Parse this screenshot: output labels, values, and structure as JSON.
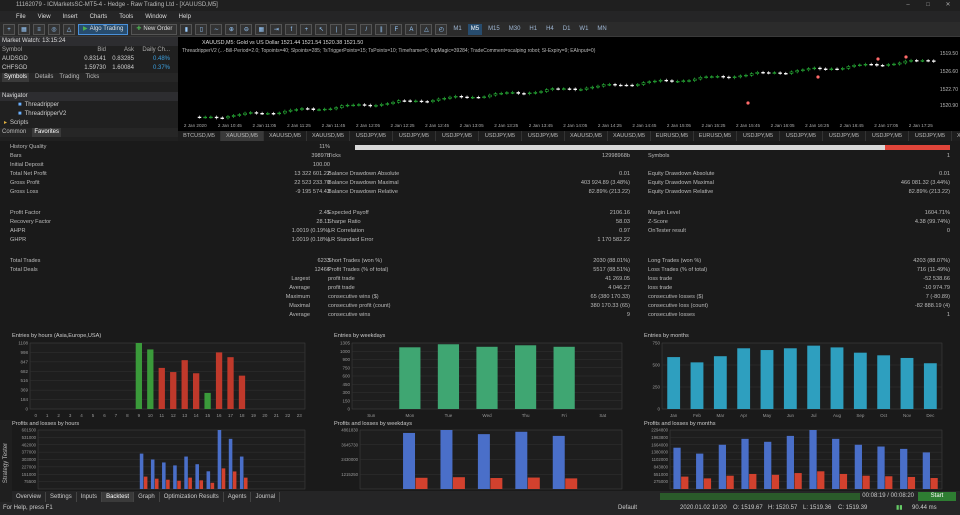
{
  "window": {
    "title": "11162079 - ICMarketsSC-MT5-4 - Hedge - Raw Trading Ltd - [XAUUSD,M5]"
  },
  "menu": [
    "File",
    "View",
    "Insert",
    "Charts",
    "Tools",
    "Window",
    "Help"
  ],
  "toolbar": {
    "algo_label": "Algo Trading",
    "new_order_label": "New Order",
    "timeframes": [
      "M1",
      "M5",
      "M15",
      "M30",
      "H1",
      "H4",
      "D1",
      "W1",
      "MN"
    ],
    "selected_timeframe": "M5"
  },
  "market_watch": {
    "title": "Market Watch: 13:15:24",
    "columns": [
      "Symbol",
      "Bid",
      "Ask",
      "Daily Ch..."
    ],
    "rows": [
      {
        "symbol": "AUDSGD",
        "bid": "0.83141",
        "ask": "0.83285",
        "change": "0.48%"
      },
      {
        "symbol": "CHFSGD",
        "bid": "1.59730",
        "ask": "1.60084",
        "change": "0.37%"
      }
    ],
    "tabs": [
      "Symbols",
      "Details",
      "Trading",
      "Ticks"
    ]
  },
  "navigator": {
    "title": "Navigator",
    "items": [
      "Threadripper",
      "ThreadripperV2",
      "Scripts"
    ],
    "tabs": [
      "Common",
      "Favorites"
    ]
  },
  "chart": {
    "header": "XAUUSD,M5: Gold vs US Dollar 1521.44 1521.54 1520.38 1521.50",
    "params": "ThreadripperV2 (...-Bill-Period=2.0; Topoints=40; Slpoints=285; TsTriggerPoints=15; TsPoints=10; Timeframe=5; InpMagic=39284; TradeComment=scalping robot; Sl-Expiry=9; EAInput=0)",
    "price_labels": [
      "1519.50",
      "1526.60",
      "1522.70",
      "1520.90"
    ],
    "time_labels": [
      "2 Jan 2020",
      "2 Jan 10:45",
      "2 Jan 11:05",
      "2 Jan 11:25",
      "2 Jan 11:45",
      "2 Jan 12:05",
      "2 Jan 12:25",
      "2 Jan 12:45",
      "2 Jan 13:05",
      "2 Jan 13:25",
      "2 Jan 13:45",
      "2 Jan 14:05",
      "2 Jan 14:25",
      "2 Jan 14:45",
      "2 Jan 15:05",
      "2 Jan 15:25",
      "2 Jan 15:45",
      "2 Jan 16:05",
      "2 Jan 16:25",
      "2 Jan 16:45",
      "2 Jan 17:05",
      "2 Jan 17:25"
    ],
    "tabs": [
      "BTCUSD,M5",
      "XAUUSD,M5",
      "XAUUSD,M5",
      "XAUUSD,M5",
      "USDJPY,M5",
      "USDJPY,M5",
      "USDJPY,M5",
      "USDJPY,M5",
      "USDJPY,M5",
      "XAUUSD,M5",
      "XAUUSD,M5",
      "EURUSD,M5",
      "EURUSD,M5",
      "USDJPY,M5",
      "USDJPY,M5",
      "USDJPY,M5",
      "USDJPY,M5",
      "USDJPY,M5",
      "XAUUSD,M5",
      "XAUUSD,M5",
      "XAUUSD,M5",
      "XAUI"
    ]
  },
  "stats": {
    "history_quality": {
      "label": "History Quality",
      "value": "11%",
      "fraction": 0.11
    },
    "bars": {
      "label": "Bars",
      "value": "39897b"
    },
    "ticks": {
      "label": "Ticks",
      "value": "12998968b"
    },
    "symbols": {
      "label": "Symbols",
      "value": "1"
    },
    "initial_deposit": {
      "label": "Initial Deposit",
      "value": "100.00"
    },
    "rows": [
      [
        {
          "label": "Total Net Profit",
          "value": "13 322 601.22"
        },
        {
          "label": "Balance Drawdown Absolute",
          "value": "0.01"
        },
        {
          "label": "Equity Drawdown Absolute",
          "value": "0.01"
        }
      ],
      [
        {
          "label": "Gross Profit",
          "value": "22 523 233.70"
        },
        {
          "label": "Balance Drawdown Maximal",
          "value": "403 924.89 (3.48%)"
        },
        {
          "label": "Equity Drawdown Maximal",
          "value": "466 081.32 (3.44%)"
        }
      ],
      [
        {
          "label": "Gross Loss",
          "value": "-9 195 574.43"
        },
        {
          "label": "Balance Drawdown Relative",
          "value": "82.89% (213.22)"
        },
        {
          "label": "Equity Drawdown Relative",
          "value": "82.89% (213.22)"
        }
      ]
    ],
    "rows2": [
      [
        {
          "label": "Profit Factor",
          "value": "2.45"
        },
        {
          "label": "Expected Payoff",
          "value": "2106.16"
        },
        {
          "label": "Margin Level",
          "value": "1604.71%"
        }
      ],
      [
        {
          "label": "Recovery Factor",
          "value": "28.11"
        },
        {
          "label": "Sharpe Ratio",
          "value": "58.03"
        },
        {
          "label": "Z-Score",
          "value": "4.38 (99.74%)"
        }
      ],
      [
        {
          "label": "AHPR",
          "value": "1.0019 (0.19%)"
        },
        {
          "label": "LR Correlation",
          "value": "0.97"
        },
        {
          "label": "OnTester result",
          "value": "0"
        }
      ],
      [
        {
          "label": "GHPR",
          "value": "1.0019 (0.18%)"
        },
        {
          "label": "LR Standard Error",
          "value": "1 170 582.22"
        },
        {
          "label": "",
          "value": ""
        }
      ]
    ],
    "trades": [
      {
        "label": "Total Trades",
        "value": "6233",
        "l2": "Short Trades (won %)",
        "v2": "2030 (88.01%)",
        "l3": "Long Trades (won %)",
        "v3": "4203 (88.07%)"
      },
      {
        "label": "Total Deals",
        "value": "12466",
        "l2": "Profit Trades (% of total)",
        "v2": "5517 (88.51%)",
        "l3": "Loss Trades (% of total)",
        "v3": "716 (11.49%)"
      },
      {
        "label": "Largest",
        "value": "",
        "l2": "profit trade",
        "v2": "41 269.05",
        "l3": "loss trade",
        "v3": "-52 538.66"
      },
      {
        "label": "Average",
        "value": "",
        "l2": "profit trade",
        "v2": "4 046.27",
        "l3": "loss trade",
        "v3": "-10 974.79"
      },
      {
        "label": "Maximum",
        "value": "",
        "l2": "consecutive wins ($)",
        "v2": "65 (380 170.33)",
        "l3": "consecutive losses ($)",
        "v3": "7 (-80.89)"
      },
      {
        "label": "Maximal",
        "value": "",
        "l2": "consecutive profit (count)",
        "v2": "380 170.33 (65)",
        "l3": "consecutive loss (count)",
        "v3": "-82 888.19 (4)"
      },
      {
        "label": "Average",
        "value": "",
        "l2": "consecutive wins",
        "v2": "9",
        "l3": "consecutive losses",
        "v3": "1"
      }
    ]
  },
  "panels": {
    "hours": {
      "title": "Entries by hours (Asia,Europe,USA)",
      "y": [
        "1108",
        "998",
        "847",
        "682",
        "516",
        "369",
        "184",
        "0"
      ],
      "x": [
        "0",
        "1",
        "2",
        "3",
        "4",
        "5",
        "6",
        "7",
        "8",
        "9",
        "10",
        "11",
        "12",
        "13",
        "14",
        "15",
        "16",
        "17",
        "18",
        "19",
        "20",
        "21",
        "22",
        "23"
      ]
    },
    "weekdays": {
      "title": "Entries by weekdays",
      "y": [
        "1305",
        "1000",
        "900",
        "750",
        "600",
        "450",
        "300",
        "150",
        "0"
      ],
      "x": [
        "Sun",
        "Mon",
        "Tue",
        "Wed",
        "Thu",
        "Fri",
        "Sat"
      ]
    },
    "months": {
      "title": "Entries by months",
      "y": [
        "750",
        "500",
        "250",
        "0"
      ],
      "x": [
        "Jan",
        "Feb",
        "Mar",
        "Apr",
        "May",
        "Jun",
        "Jul",
        "Aug",
        "Sep",
        "Oct",
        "Nov",
        "Dec"
      ]
    },
    "pl_hours": {
      "title": "Profits and losses by hours",
      "y": [
        "601500",
        "531000",
        "462000",
        "377000",
        "303000",
        "227000",
        "151000",
        "75500"
      ]
    },
    "pl_weekdays": {
      "title": "Profits and losses by weekdays",
      "y": [
        "4861830",
        "3645730",
        "2430000",
        "1215250"
      ]
    },
    "pl_months": {
      "title": "Profits and losses by months",
      "y": [
        "2294800",
        "1963800",
        "1664000",
        "1380000",
        "1102000",
        "843800",
        "551000",
        "275000"
      ]
    }
  },
  "chart_data": [
    {
      "type": "bar",
      "title": "Entries by hours (Asia,Europe,USA)",
      "categories": [
        "0",
        "1",
        "2",
        "3",
        "4",
        "5",
        "6",
        "7",
        "8",
        "9",
        "10",
        "11",
        "12",
        "13",
        "14",
        "15",
        "16",
        "17",
        "18",
        "19",
        "20",
        "21",
        "22",
        "23"
      ],
      "series": [
        {
          "values": [
            0,
            0,
            0,
            0,
            0,
            0,
            0,
            0,
            0,
            1108,
            1000,
            690,
            620,
            820,
            600,
            270,
            950,
            870,
            560,
            0,
            0,
            0,
            0,
            0
          ]
        }
      ],
      "ylim": [
        0,
        1108
      ]
    },
    {
      "type": "bar",
      "title": "Entries by weekdays",
      "categories": [
        "Sun",
        "Mon",
        "Tue",
        "Wed",
        "Thu",
        "Fri",
        "Sat"
      ],
      "series": [
        {
          "values": [
            0,
            1220,
            1280,
            1230,
            1260,
            1230,
            0
          ]
        }
      ],
      "ylim": [
        0,
        1305
      ]
    },
    {
      "type": "bar",
      "title": "Entries by months",
      "categories": [
        "Jan",
        "Feb",
        "Mar",
        "Apr",
        "May",
        "Jun",
        "Jul",
        "Aug",
        "Sep",
        "Oct",
        "Nov",
        "Dec"
      ],
      "series": [
        {
          "values": [
            590,
            530,
            600,
            690,
            670,
            690,
            720,
            700,
            640,
            610,
            580,
            520
          ]
        }
      ],
      "ylim": [
        0,
        750
      ]
    }
  ],
  "bottom": {
    "tabs": [
      "Overview",
      "Settings",
      "Inputs",
      "Backtest",
      "Graph",
      "Optimization Results",
      "Agents",
      "Journal"
    ],
    "selected": "Backtest",
    "timer": "00:08:19 / 00:08:20",
    "start_label": "Start",
    "side_label": "Strategy Tester"
  },
  "status": {
    "help": "For Help, press F1",
    "profile": "Default",
    "date": "2020.01.02 10:20",
    "open": "O: 1519.67",
    "high": "H: 1520.57",
    "low": "L: 1519.36",
    "close": "C: 1519.39",
    "ping": "90.44 ms"
  }
}
